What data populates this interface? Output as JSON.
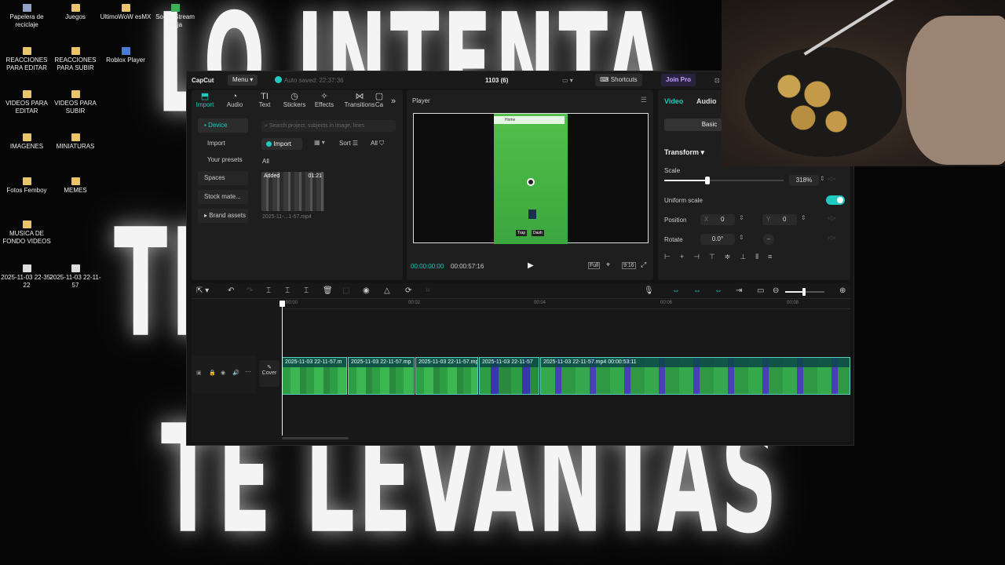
{
  "background_text": {
    "line1": "LO INTENTA",
    "line2": "TE CAES",
    "line3": "TE LEVANTAS"
  },
  "desktop_icons": [
    {
      "label": "Papelera de reciclaje",
      "icon": "recycle-bin-icon"
    },
    {
      "label": "Juegos",
      "icon": "folder-icon"
    },
    {
      "label": "UltimoWoW esMX",
      "icon": "folder-icon"
    },
    {
      "label": "Social Stream Ninja",
      "icon": "app-icon"
    },
    {
      "label": "REACCIONES PARA EDITAR",
      "icon": "folder-icon"
    },
    {
      "label": "REACCIONES PARA SUBIR",
      "icon": "folder-icon"
    },
    {
      "label": "Roblox Player",
      "icon": "roblox-icon"
    },
    {
      "label": "VIDEOS PARA EDITAR",
      "icon": "folder-icon"
    },
    {
      "label": "VIDEOS PARA SUBIR",
      "icon": "folder-icon"
    },
    {
      "label": "IMAGENES",
      "icon": "folder-icon"
    },
    {
      "label": "MINIATURAS",
      "icon": "folder-icon"
    },
    {
      "label": "Fotos Femboy",
      "icon": "folder-icon"
    },
    {
      "label": "MEMES",
      "icon": "folder-icon"
    },
    {
      "label": "MUSICA DE FONDO VIDEOS",
      "icon": "folder-icon"
    },
    {
      "label": "2025-11-03 22-35-22",
      "icon": "video-file-icon"
    },
    {
      "label": "2025-11-03 22-11-57",
      "icon": "video-file-icon"
    }
  ],
  "capcut": {
    "logo": "CapCut",
    "menu": "Menu",
    "autosave": "Auto saved: 22:37:36",
    "project_title": "1103 (6)",
    "shortcuts": "Shortcuts",
    "join_pro": "Join Pro",
    "tabs": [
      {
        "label": "Import",
        "icon": "import-icon"
      },
      {
        "label": "Audio",
        "icon": "audio-icon"
      },
      {
        "label": "Text",
        "icon": "text-icon"
      },
      {
        "label": "Stickers",
        "icon": "stickers-icon"
      },
      {
        "label": "Effects",
        "icon": "effects-icon"
      },
      {
        "label": "Transitions",
        "icon": "transitions-icon"
      },
      {
        "label": "Ca",
        "icon": "captions-icon"
      }
    ],
    "sidebar": {
      "device": "Device",
      "import": "Import",
      "presets": "Your presets",
      "spaces": "Spaces",
      "stock": "Stock mate...",
      "brand": "Brand assets"
    },
    "media": {
      "search_placeholder": "Search project, subjects in image, lines",
      "import_button": "Import",
      "sort": "Sort",
      "all_filter": "All",
      "all_heading": "All",
      "thumb_badge": "Added",
      "thumb_duration": "01:21",
      "thumb_name": "2025-11-...1-57.mp4"
    },
    "player": {
      "title": "Player",
      "current_time": "00:00:00:00",
      "total_time": "00:00:57:16",
      "full": "Full",
      "ratio": "9:16",
      "game_button1": "Trap",
      "game_button2": "Dash",
      "game_top": "Home"
    },
    "properties": {
      "tab_video": "Video",
      "tab_audio": "Audio",
      "basic": "Basic",
      "transform": "Transform",
      "scale_label": "Scale",
      "scale_value": "318%",
      "scale_fraction": 0.36,
      "uniform_scale": "Uniform scale",
      "position_label": "Position",
      "pos_x_label": "X",
      "pos_x": "0",
      "pos_y_label": "Y",
      "pos_y": "0",
      "rotate_label": "Rotate",
      "rotate_value": "0.0°"
    },
    "timeline": {
      "ruler": [
        "00:00",
        "00:02",
        "00:04",
        "00:06",
        "00:08"
      ],
      "cover": "Cover",
      "clips": [
        {
          "label": "2025-11-03 22-11-57.m"
        },
        {
          "label": "2025-11-03 22-11-57.mp"
        },
        {
          "label": "2025-11-03 22-11-57.mp"
        },
        {
          "label": "2025-11-03 22-11-57"
        },
        {
          "label": "2025-11-03 22-11-57.mp4   00:00:53:11"
        }
      ]
    }
  },
  "colors": {
    "accent": "#20c8c0",
    "join_pro": "#c9a4ff",
    "clip_border": "#58d0c0"
  }
}
